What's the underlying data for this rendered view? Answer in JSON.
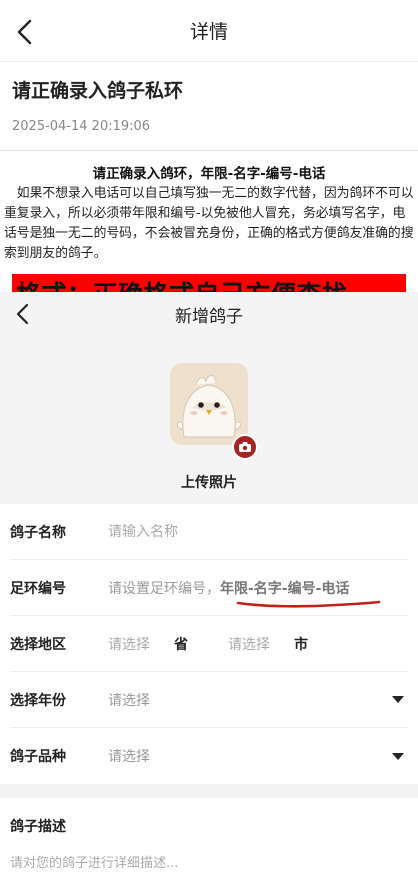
{
  "header": {
    "title": "详情",
    "back_icon": "chevron-left-icon"
  },
  "article": {
    "title": "请正确录入鸽子私环",
    "date": "2025-04-14 20:19:06",
    "headline": "请正确录入鸽环，年限-名字-编号-电话",
    "body": "如果不想录入电话可以自己填写独一无二的数字代替，因为鸽环不可以重复录入，所以必须带年限和编号-以免被他人冒充，务必填写名字，电话号是独一无二的号码，不会被冒充身份，正确的格式方便鸽友准确的搜索到朋友的鸽子。",
    "banner": "格式：正确格式自己方便查找...",
    "banner_color": "#ff0000"
  },
  "screenshot": {
    "header_title": "新增鸽子",
    "upload_label": "上传照片",
    "camera_badge_color": "#a52421",
    "form": {
      "name_label": "鸽子名称",
      "name_placeholder": "请输入名称",
      "ring_label": "足环编号",
      "ring_placeholder": "请设置足环编号，",
      "ring_format": "年限-名字-编号-电话",
      "underline_color": "#c0201a",
      "region_label": "选择地区",
      "province_placeholder": "请选择",
      "province_unit": "省",
      "city_placeholder": "请选择",
      "city_unit": "市",
      "year_label": "选择年份",
      "year_value": "请选择",
      "breed_label": "鸽子品种",
      "breed_value": "请选择"
    },
    "description": {
      "label": "鸽子描述",
      "placeholder": "请对您的鸽子进行详细描述..."
    }
  }
}
